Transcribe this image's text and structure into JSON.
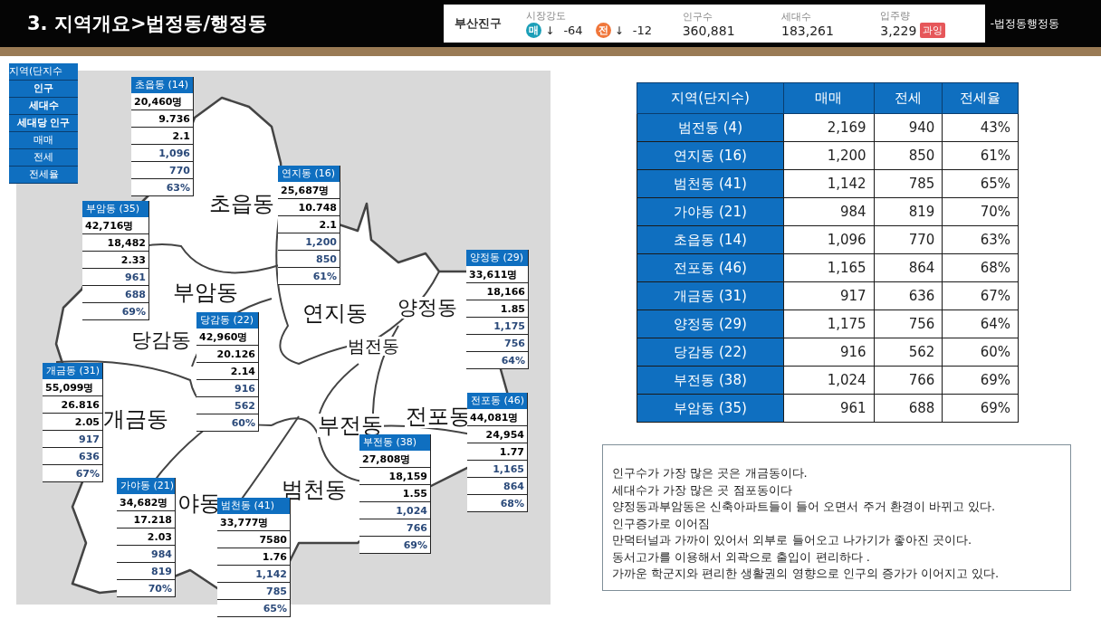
{
  "header": {
    "title": "3. 지역개요>법정동/행정동",
    "breadcrumb": "-법정동행정동"
  },
  "stats": {
    "region": "부산진구",
    "market": {
      "label": "시장강도",
      "items": [
        {
          "badge": "매",
          "arrow": "↓",
          "value": "-64",
          "color": "#1b9fb8"
        },
        {
          "badge": "전",
          "arrow": "↓",
          "value": "-12",
          "color": "#f0763a"
        }
      ]
    },
    "metrics": [
      {
        "label": "인구수",
        "value": "360,881"
      },
      {
        "label": "세대수",
        "value": "183,261"
      },
      {
        "label": "입주량",
        "value": "3,229",
        "tag": "과잉"
      }
    ]
  },
  "legend": {
    "header": "지역(단지수",
    "rows": [
      "인구",
      "세대수",
      "세대당 인구",
      "매매",
      "전세",
      "전세율"
    ]
  },
  "map": {
    "districts": [
      "초읍동",
      "부암동",
      "연지동",
      "양정동",
      "당감동",
      "범전동",
      "개금동",
      "부전동",
      "전포동",
      "범천동",
      "야동"
    ],
    "callouts": [
      {
        "title": "초읍동 (14)",
        "values": [
          "20,460명",
          "9.736",
          "2.1",
          "1,096",
          "770",
          "63%"
        ]
      },
      {
        "title": "연지동 (16)",
        "values": [
          "25,687명",
          "10.748",
          "2.1",
          "1,200",
          "850",
          "61%"
        ]
      },
      {
        "title": "부암동 (35)",
        "values": [
          "42,716명",
          "18,482",
          "2.33",
          "961",
          "688",
          "69%"
        ]
      },
      {
        "title": "양정동 (29)",
        "values": [
          "33,611명",
          "18,166",
          "1.85",
          "1,175",
          "756",
          "64%"
        ]
      },
      {
        "title": "당감동 (22)",
        "values": [
          "42,960명",
          "20.126",
          "2.14",
          "916",
          "562",
          "60%"
        ]
      },
      {
        "title": "개금동 (31)",
        "values": [
          "55,099명",
          "26.816",
          "2.05",
          "917",
          "636",
          "67%"
        ]
      },
      {
        "title": "전포동 (46)",
        "values": [
          "44,081명",
          "24,954",
          "1.77",
          "1,165",
          "864",
          "68%"
        ]
      },
      {
        "title": "부전동 (38)",
        "values": [
          "27,808명",
          "18,159",
          "1.55",
          "1,024",
          "766",
          "69%"
        ]
      },
      {
        "title": "가야동 (21)",
        "values": [
          "34,682명",
          "17.218",
          "2.03",
          "984",
          "819",
          "70%"
        ]
      },
      {
        "title": "범천동 (41)",
        "values": [
          "33,777명",
          "7580",
          "1.76",
          "1,142",
          "785",
          "65%"
        ]
      }
    ]
  },
  "summary_table": {
    "columns": [
      "지역(단지수)",
      "매매",
      "전세",
      "전세율"
    ],
    "rows": [
      [
        "범전동 (4)",
        "2,169",
        "940",
        "43%"
      ],
      [
        "연지동 (16)",
        "1,200",
        "850",
        "61%"
      ],
      [
        "범천동 (41)",
        "1,142",
        "785",
        "65%"
      ],
      [
        "가야동 (21)",
        "984",
        "819",
        "70%"
      ],
      [
        "초읍동 (14)",
        "1,096",
        "770",
        "63%"
      ],
      [
        "전포동 (46)",
        "1,165",
        "864",
        "68%"
      ],
      [
        "개금동 (31)",
        "917",
        "636",
        "67%"
      ],
      [
        "양정동 (29)",
        "1,175",
        "756",
        "64%"
      ],
      [
        "당감동 (22)",
        "916",
        "562",
        "60%"
      ],
      [
        "부전동 (38)",
        "1,024",
        "766",
        "69%"
      ],
      [
        "부암동 (35)",
        "961",
        "688",
        "69%"
      ]
    ]
  },
  "notes": [
    "인구수가 가장 많은 곳은 개금동이다.",
    "세대수가 가장 많은 곳 점포동이다",
    "양정동과부암동은  신축아파트들이 들어 오면서 주거 환경이 바뀌고 있다.",
    "인구증가로 이어짐",
    "만덕터널과  가까이 있어서 외부로 들어오고 나가기가 좋아진 곳이다.",
    "동서고가를 이용해서 외곽으로 출입이 편리하다 .",
    "가까운 학군지와 편리한 생활권의 영향으로 인구의 증가가 이어지고 있다."
  ]
}
